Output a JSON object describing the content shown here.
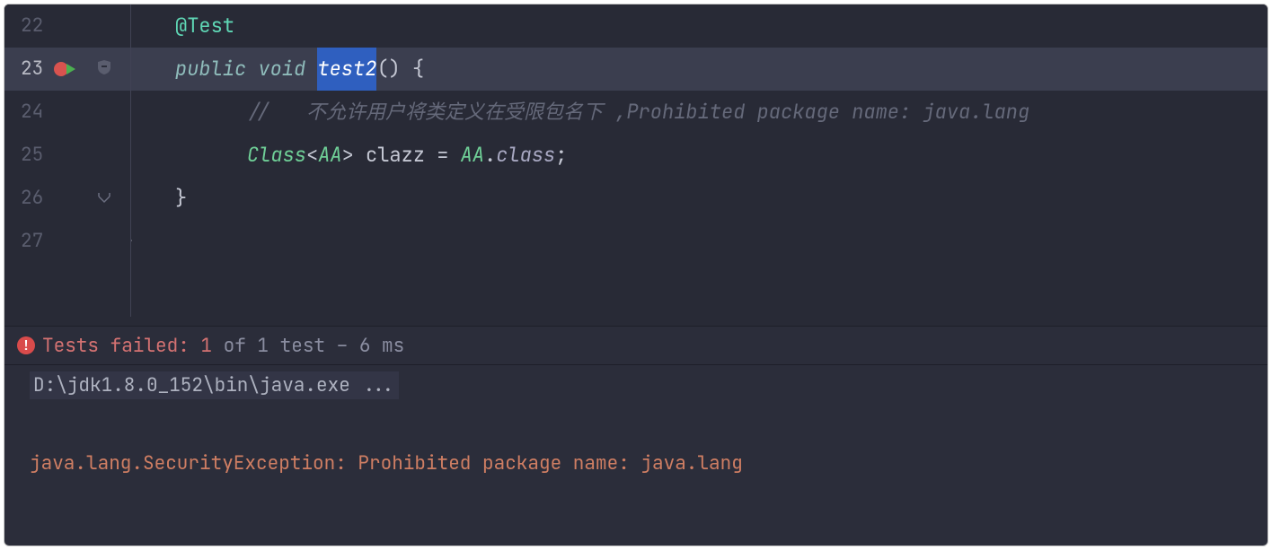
{
  "editor": {
    "lines": {
      "22": {
        "num": "22",
        "annotation": "@Test"
      },
      "23": {
        "num": "23",
        "kw_public": "public",
        "kw_void": "void",
        "method": "test2",
        "after": "() {"
      },
      "24": {
        "num": "24",
        "comment": "//   不允许用户将类定义在受限包名下 ,Prohibited package name: java.lang"
      },
      "25": {
        "num": "25",
        "cls": "Class",
        "gen": "AA",
        "var": " clazz = ",
        "ref": "AA",
        "dot": ".",
        "clskw": "class",
        "semi": ";"
      },
      "26": {
        "num": "26",
        "brace": "}"
      },
      "27": {
        "num": "27",
        "brace": "}"
      }
    }
  },
  "console": {
    "status_prefix": "Tests failed: ",
    "failed_count": "1",
    "status_mid": " of ",
    "total_count": "1",
    "status_suffix": " test – ",
    "duration": "6 ms",
    "command": "D:\\jdk1.8.0_152\\bin\\java.exe ...",
    "exception": "java.lang.SecurityException: Prohibited package name: java.lang"
  }
}
